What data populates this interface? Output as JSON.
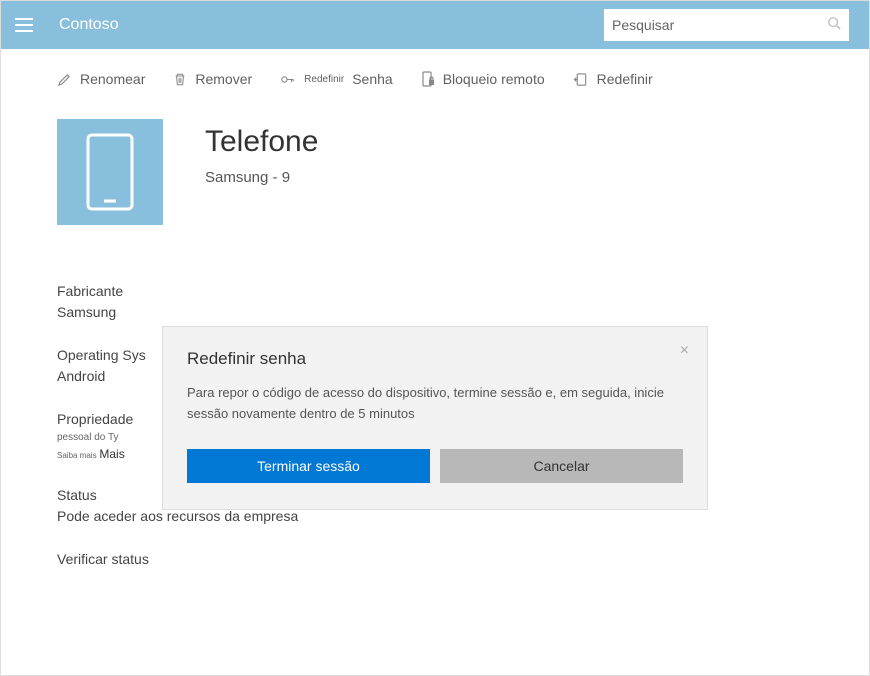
{
  "header": {
    "brand": "Contoso",
    "search_placeholder": "Pesquisar"
  },
  "toolbar": {
    "rename": "Renomear",
    "remove": "Remover",
    "reset_pw_prefix": "Redefinir",
    "reset_pw_suffix": "Senha",
    "remote_lock": "Bloqueio remoto",
    "reset": "Redefinir"
  },
  "device": {
    "title": "Telefone",
    "subtitle": "Samsung - 9"
  },
  "details": {
    "manufacturer_label": "Fabricante",
    "manufacturer_value": "Samsung",
    "os_label": "Operating Sys",
    "os_value": "Android",
    "ownership_label": "Propriedade",
    "ownership_value": "pessoal do Ty",
    "see_more_prefix": "Saiba mais",
    "see_more_link": "Mais",
    "status_label": "Status",
    "status_value": "Pode aceder aos recursos da empresa",
    "verify_status": "Verificar status"
  },
  "modal": {
    "title": "Redefinir senha",
    "text": "Para repor o código de acesso do dispositivo, termine sessão e, em seguida, inicie sessão novamente dentro de 5 minutos",
    "primary": "Terminar sessão",
    "secondary": "Cancelar"
  }
}
